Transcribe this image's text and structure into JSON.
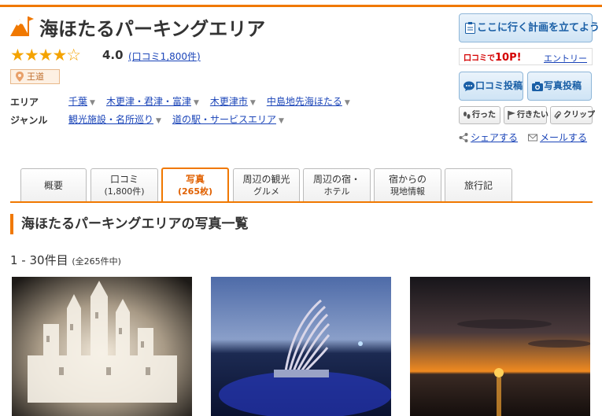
{
  "header": {
    "title": "海ほたるパーキングエリア",
    "stars": "★★★★☆",
    "score": "4.0",
    "review_count": "(口コミ1,800件)",
    "badge": "王道"
  },
  "info": {
    "area_label": "エリア",
    "area_items": [
      "千葉",
      "木更津・君津・富津",
      "木更津市",
      "中島地先海ほたる"
    ],
    "genre_label": "ジャンル",
    "genre_items": [
      "観光施設・名所巡り",
      "道の駅・サービスエリア"
    ]
  },
  "actions": {
    "plan_label": "ここに行く計画を立てよう",
    "promo_prefix": "口コミで",
    "promo_points": "10P!",
    "entry_link": "エントリー",
    "review_post": "口コミ投稿",
    "photo_post": "写真投稿",
    "went": "行った",
    "want_to_go": "行きたい",
    "clip": "クリップ",
    "share": "シェアする",
    "mail": "メールする"
  },
  "tabs": [
    {
      "label": "概要",
      "sub": ""
    },
    {
      "label": "口コミ",
      "sub": "(1,800件)"
    },
    {
      "label": "写真",
      "sub": "(265枚)"
    },
    {
      "label": "周辺の観光",
      "sub": "グルメ"
    },
    {
      "label": "周辺の宿・",
      "sub": "ホテル"
    },
    {
      "label": "宿からの",
      "sub": "現地情報"
    },
    {
      "label": "旅行記",
      "sub": ""
    }
  ],
  "active_tab": "写真",
  "section": {
    "title": "海ほたるパーキングエリアの写真一覧",
    "count_main": "1 - 30件目",
    "count_sub": "(全265件中)"
  },
  "colors": {
    "accent": "#f07800",
    "link": "#1a44b8",
    "star": "#f4a300",
    "button_text": "#1a5fa6"
  }
}
